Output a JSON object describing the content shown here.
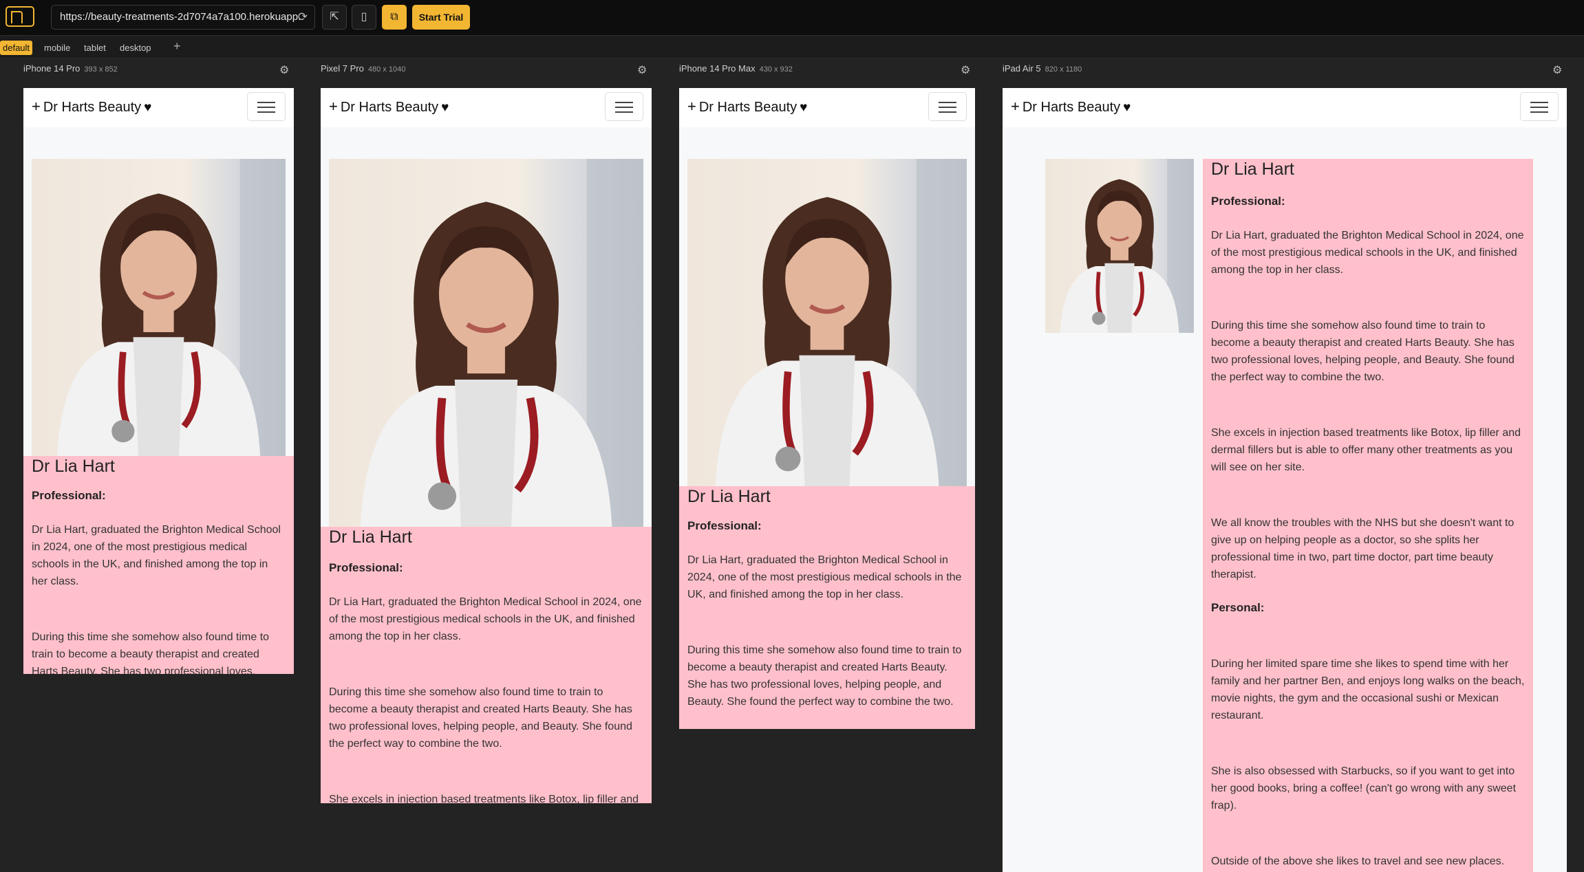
{
  "toolbar": {
    "url": "https://beauty-treatments-2d7074a7a100.herokuapp.",
    "trial_label": "Start Trial",
    "icons": [
      "app-logo-icon",
      "refresh-icon",
      "inspect-icon",
      "mobile-icon",
      "devices-icon"
    ]
  },
  "tabs": [
    {
      "label": "default",
      "active": true
    },
    {
      "label": "mobile"
    },
    {
      "label": "tablet"
    },
    {
      "label": "desktop"
    }
  ],
  "add_tab": "+",
  "devices": [
    {
      "name": "iPhone 14 Pro",
      "dims": "393 x 852"
    },
    {
      "name": "Pixel 7 Pro",
      "dims": "480 x 1040"
    },
    {
      "name": "iPhone 14 Pro Max",
      "dims": "430 x 932"
    },
    {
      "name": "iPad Air 5",
      "dims": "820 x 1180"
    }
  ],
  "site": {
    "brand_plus": "+",
    "brand": "Dr Harts Beauty",
    "brand_heart": "♥",
    "name": "Dr Lia Hart",
    "professional_label": "Professional:",
    "personal_label": "Personal:",
    "p1": "Dr Lia Hart, graduated the Brighton Medical School in 2024, one of the most prestigious medical schools in the UK, and finished among the top in her class.",
    "p2": "During this time she somehow also found time to train to become a beauty therapist and created Harts Beauty. She has two professional loves, helping people, and Beauty. She found the perfect way to combine the two.",
    "p3": "She excels in injection based treatments like Botox, lip filler and dermal fillers but is able to offer many other treatments as you will see on her site.",
    "p4": "We all know the troubles with the NHS but she doesn't want to give up on helping people as a doctor, so she splits her professional time in two, part time doctor, part time beauty therapist.",
    "p5": "During her limited spare time she likes to spend time with her family and her partner Ben, and enjoys long walks on the beach, movie nights, the gym and the occasional sushi or Mexican restaurant.",
    "p6": "She is also obsessed with Starbucks, so if you want to get into her good books, bring a coffee! (can't go wrong with any sweet frap).",
    "p7": "Outside of the above she likes to travel and see new places."
  },
  "colors": {
    "accent": "#f3b632",
    "pink_panel": "#ffc0cb",
    "topbar": "#0d0d0d",
    "workspace": "#232323"
  }
}
